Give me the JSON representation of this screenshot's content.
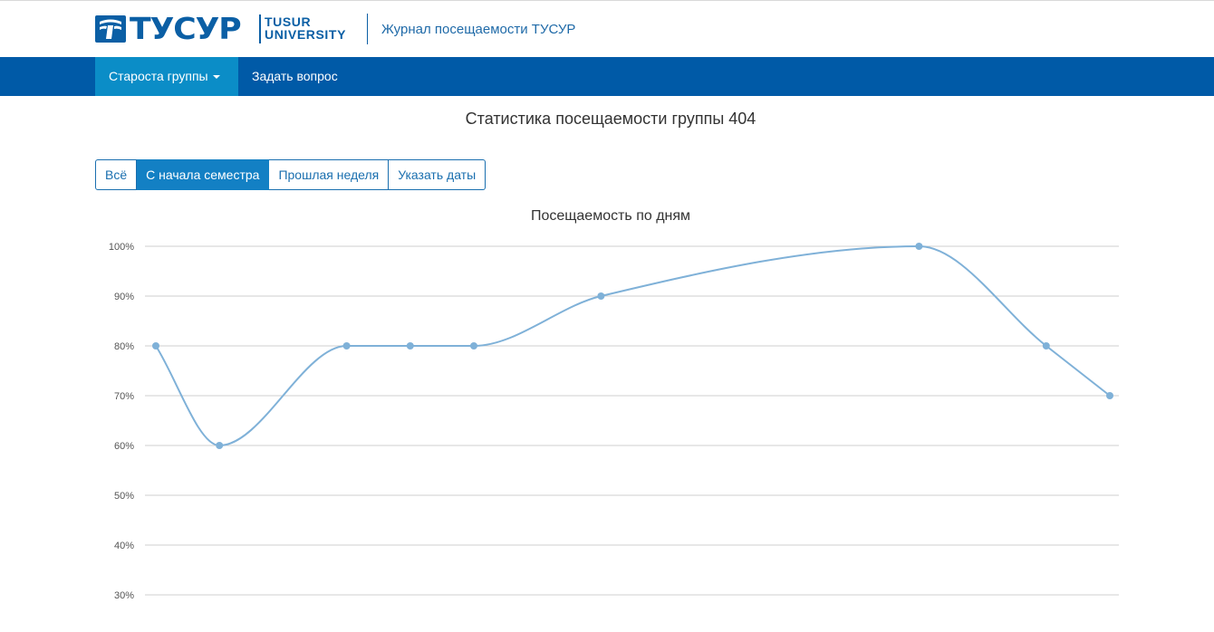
{
  "header": {
    "logo_text": "ТУСУР",
    "logo_en_line1": "TUSUR",
    "logo_en_line2": "UNIVERSITY",
    "app_title": "Журнал посещаемости ТУСУР"
  },
  "navbar": {
    "items": [
      {
        "label": "Староста группы",
        "active": true,
        "dropdown": true
      },
      {
        "label": "Задать вопрос",
        "active": false,
        "dropdown": false
      }
    ]
  },
  "page": {
    "title": "Статистика посещаемости группы 404"
  },
  "filters": {
    "buttons": [
      {
        "label": "Всё",
        "active": false
      },
      {
        "label": "С начала семестра",
        "active": true
      },
      {
        "label": "Прошлая неделя",
        "active": false
      },
      {
        "label": "Указать даты",
        "active": false
      }
    ]
  },
  "colors": {
    "brand": "#005aa7",
    "nav_active": "#0b8dc7",
    "series": "#7fb1d8"
  },
  "chart_data": {
    "type": "line",
    "title": "Посещаемость по дням",
    "ylim": [
      30,
      100
    ],
    "yticks": [
      "100%",
      "90%",
      "80%",
      "70%",
      "60%",
      "50%",
      "40%",
      "30%"
    ],
    "grid": true,
    "series": [
      {
        "values": [
          80,
          60,
          80,
          80,
          80,
          90,
          100,
          80,
          70
        ]
      }
    ]
  }
}
